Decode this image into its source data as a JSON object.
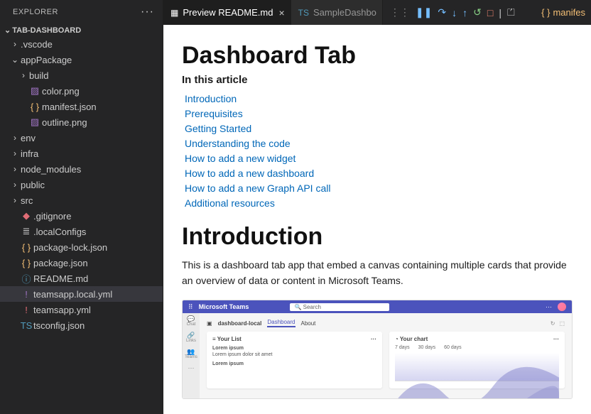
{
  "sidebar": {
    "title": "EXPLORER",
    "project": "TAB-DASHBOARD",
    "tree": [
      {
        "label": ".vscode",
        "type": "folder",
        "depth": 1,
        "expanded": false
      },
      {
        "label": "appPackage",
        "type": "folder",
        "depth": 1,
        "expanded": true
      },
      {
        "label": "build",
        "type": "folder",
        "depth": 2,
        "expanded": false
      },
      {
        "label": "color.png",
        "type": "image",
        "depth": 2
      },
      {
        "label": "manifest.json",
        "type": "json-braces",
        "depth": 2
      },
      {
        "label": "outline.png",
        "type": "image",
        "depth": 2
      },
      {
        "label": "env",
        "type": "folder",
        "depth": 1,
        "expanded": false
      },
      {
        "label": "infra",
        "type": "folder",
        "depth": 1,
        "expanded": false
      },
      {
        "label": "node_modules",
        "type": "folder",
        "depth": 1,
        "expanded": false
      },
      {
        "label": "public",
        "type": "folder",
        "depth": 1,
        "expanded": false
      },
      {
        "label": "src",
        "type": "folder",
        "depth": 1,
        "expanded": false
      },
      {
        "label": ".gitignore",
        "type": "git",
        "depth": 1
      },
      {
        "label": ".localConfigs",
        "type": "lines",
        "depth": 1
      },
      {
        "label": "package-lock.json",
        "type": "json-braces",
        "depth": 1
      },
      {
        "label": "package.json",
        "type": "json-braces",
        "depth": 1
      },
      {
        "label": "README.md",
        "type": "info",
        "depth": 1
      },
      {
        "label": "teamsapp.local.yml",
        "type": "yaml-purple",
        "depth": 1,
        "selected": true
      },
      {
        "label": "teamsapp.yml",
        "type": "yaml-red",
        "depth": 1
      },
      {
        "label": "tsconfig.json",
        "type": "ts",
        "depth": 1
      }
    ]
  },
  "tabs": {
    "tab1": {
      "label": "Preview README.md",
      "icon": "▦"
    },
    "tab2": {
      "label": "SampleDashbo",
      "icon": "TS"
    },
    "right": {
      "icon": "{ }",
      "label": "manifes"
    }
  },
  "preview": {
    "h1": "Dashboard Tab",
    "subtitle": "In this article",
    "toc": [
      "Introduction",
      "Prerequisites",
      "Getting Started",
      "Understanding the code",
      "How to add a new widget",
      "How to add a new dashboard",
      "How to add a new Graph API call",
      "Additional resources"
    ],
    "section_title": "Introduction",
    "intro_p": "This is a dashboard tab app that embed a canvas containing multiple cards that provide an overview of data or content in Microsoft Teams.",
    "teams": {
      "brand": "Microsoft Teams",
      "search": "Search",
      "rail": [
        "Chat",
        "Links",
        "Teams",
        "..."
      ],
      "app_name": "dashboard-local",
      "tabline": [
        "Dashboard",
        "About"
      ],
      "card1_title": "Your List",
      "card1_item_title": "Lorem ipsum",
      "card1_item_sub": "Lorem ipsum dolor sit amet",
      "card2_title": "Your chart",
      "chart_legend": [
        "7 days",
        "30 days",
        "60 days"
      ]
    }
  }
}
